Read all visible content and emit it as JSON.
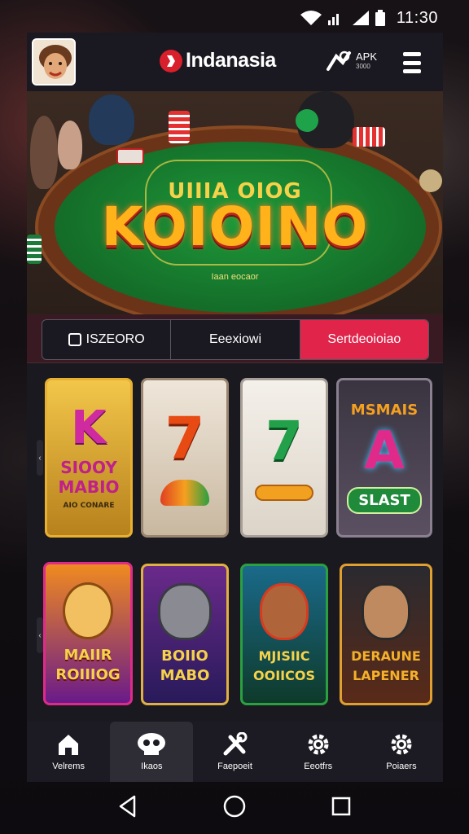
{
  "status_bar": {
    "time": "11:30"
  },
  "header": {
    "brand_name": "Indanasia",
    "apk_label": "APK",
    "apk_sub": "3000"
  },
  "hero": {
    "subtitle": "UIIIA OIOG",
    "title": "KOIOINO",
    "small_text": "Iaan eocaor"
  },
  "tabs": [
    {
      "label": "ISZEORO",
      "active": false
    },
    {
      "label": "Eeexiowi",
      "active": false
    },
    {
      "label": "Sertdeoioiao",
      "active": true
    }
  ],
  "games_row1": [
    {
      "symbol": "K",
      "text": "SIOOY MABIO",
      "tiny": "AIO CONARE"
    },
    {
      "symbol": "7",
      "text": "",
      "tiny": ""
    },
    {
      "symbol": "7",
      "text": "",
      "tiny": ""
    },
    {
      "symbol": "A",
      "text": "SLAST",
      "top": "MSMAIS"
    }
  ],
  "games_row2": [
    {
      "text": "MAIIR ROIIIOG"
    },
    {
      "text": "BOIIO MABO"
    },
    {
      "text": "MJISIIC OOIICOS"
    },
    {
      "text": "DERAUNE LAPENER"
    }
  ],
  "bottom_nav": [
    {
      "label": "Velrems",
      "icon": "home-icon",
      "active": false
    },
    {
      "label": "Ikaos",
      "icon": "skull-icon",
      "active": true
    },
    {
      "label": "Faepoeit",
      "icon": "tools-icon",
      "active": false
    },
    {
      "label": "Eeotfrs",
      "icon": "gear-icon",
      "active": false
    },
    {
      "label": "Poiaers",
      "icon": "gear-icon",
      "active": false
    }
  ],
  "colors": {
    "accent": "#e0244a",
    "brand_red": "#d81f2b",
    "felt": "#16762c"
  }
}
